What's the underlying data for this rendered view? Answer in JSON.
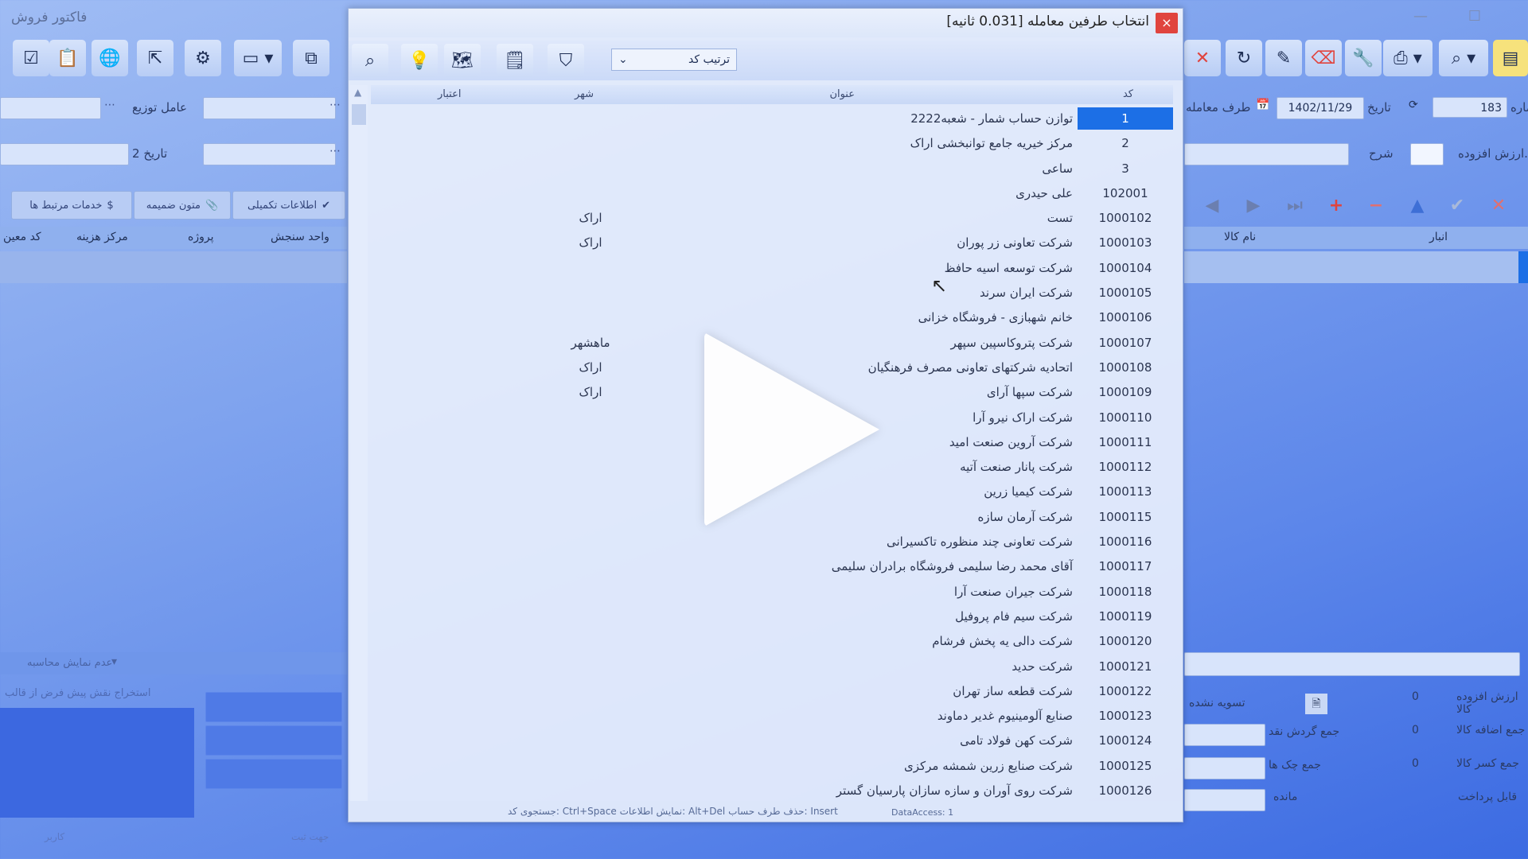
{
  "background_app": {
    "title": "فاکتور فروش",
    "labels": {
      "distribution_agent": "عامل توزیع",
      "date2": "تاریخ 2",
      "invoice_number": "شماره",
      "date": "تاریخ",
      "counterparty": "طرف معامله",
      "description": "شرح",
      "vat": "م.ارزش افزوده",
      "date_value": "1402/11/29",
      "number_value": "183"
    },
    "tabs": {
      "extra_info": "اطلاعات تکمیلی",
      "attached_docs": "متون ضمیمه",
      "services": "خدمات مرتبط ها"
    },
    "left_grid_headers": {
      "unit": "واحد سنجش",
      "project": "پروژه",
      "partner_center": "مرکز هزینه",
      "code": "کد معین"
    },
    "right_grid_headers": {
      "item_name": "نام کالا",
      "warehouse": "انبار"
    },
    "totals": {
      "vat_label": "ارزش افزوده کالا",
      "vat_value": "0",
      "added_label": "جمع اضافه کالا",
      "added_value": "0",
      "deduct_label": "جمع کسر کالا",
      "deduct_value": "0",
      "cash_total_label": "جمع گردش نقد",
      "cheques_label": "جمع چک ها",
      "balance_label": "مانده",
      "settled_label": "تسویه نشده",
      "remaining_label": "قابل پرداخت"
    },
    "bottom_left": {
      "no_show": "عدم نمایش محاسبه",
      "extract_text": "استخراج نقش پیش فرض از قالب"
    },
    "status_left": {
      "user_label": "کاربر",
      "company_label": "جهت ثبت"
    }
  },
  "dialog": {
    "title": "انتخاب طرفین معامله  [0.031 ثانیه]",
    "close_symbol": "×",
    "sort_label": "ترتیب کد",
    "columns": {
      "code": "کد",
      "title": "عنوان",
      "city": "شهر",
      "credit": "اعتبار"
    },
    "rows": [
      {
        "code": "1",
        "name": "توازن حساب شمار - شعبه2222",
        "city": ""
      },
      {
        "code": "2",
        "name": "مرکز خیریه جامع توانبخشی اراک",
        "city": ""
      },
      {
        "code": "3",
        "name": "ساعی",
        "city": ""
      },
      {
        "code": "102001",
        "name": "علی حیدری",
        "city": ""
      },
      {
        "code": "1000102",
        "name": "تست",
        "city": "اراک"
      },
      {
        "code": "1000103",
        "name": "شرکت تعاونی زر پوران",
        "city": "اراک"
      },
      {
        "code": "1000104",
        "name": "شرکت توسعه اسیه حافظ",
        "city": ""
      },
      {
        "code": "1000105",
        "name": "شرکت ایران سرند",
        "city": ""
      },
      {
        "code": "1000106",
        "name": "خانم شهبازی - فروشگاه خزانی",
        "city": ""
      },
      {
        "code": "1000107",
        "name": "شرکت پتروکاسپین سپهر",
        "city": "ماهشهر"
      },
      {
        "code": "1000108",
        "name": "اتحادیه شرکتهای تعاونی مصرف فرهنگیان",
        "city": "اراک"
      },
      {
        "code": "1000109",
        "name": "شرکت سپها آرای",
        "city": "اراک"
      },
      {
        "code": "1000110",
        "name": "شرکت اراک نیرو آرا",
        "city": ""
      },
      {
        "code": "1000111",
        "name": "شرکت آروین صنعت امید",
        "city": ""
      },
      {
        "code": "1000112",
        "name": "شرکت پانار صنعت آتیه",
        "city": ""
      },
      {
        "code": "1000113",
        "name": "شرکت کیمیا زرین",
        "city": ""
      },
      {
        "code": "1000115",
        "name": "شرکت آرمان سازه",
        "city": ""
      },
      {
        "code": "1000116",
        "name": "شرکت تعاونی چند منظوره تاکسیرانی",
        "city": ""
      },
      {
        "code": "1000117",
        "name": "آقای محمد رضا سلیمی  فروشگاه برادران سلیمی",
        "city": ""
      },
      {
        "code": "1000118",
        "name": "شرکت جیران صنعت آرا",
        "city": ""
      },
      {
        "code": "1000119",
        "name": "شرکت سیم فام پروفیل",
        "city": ""
      },
      {
        "code": "1000120",
        "name": "شرکت دالی یه پخش فرشام",
        "city": ""
      },
      {
        "code": "1000121",
        "name": "شرکت حدید",
        "city": ""
      },
      {
        "code": "1000122",
        "name": "شرکت قطعه ساز تهران",
        "city": ""
      },
      {
        "code": "1000123",
        "name": "صنایع آلومینیوم غدیر دماوند",
        "city": ""
      },
      {
        "code": "1000124",
        "name": "شرکت کهن فولاد تامی",
        "city": ""
      },
      {
        "code": "1000125",
        "name": "شرکت صنایع زرین شمشه مرکزی",
        "city": ""
      },
      {
        "code": "1000126",
        "name": "شرکت روی آوران و سازه سازان پارسیان گستر",
        "city": ""
      }
    ],
    "status_text": "جستجوی کد: Ctrl+Space   نمایش اطلاعات: Alt+Del   حذف طرف حساب: Insert",
    "data_access": "DataAccess: 1"
  },
  "colors": {
    "selection": "#1c6fe6",
    "close": "#e0443e",
    "delete_red": "#e0443e",
    "add_red": "#e0443e"
  },
  "overlay": {
    "icon": "play-icon"
  }
}
